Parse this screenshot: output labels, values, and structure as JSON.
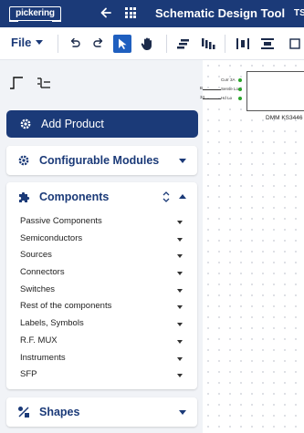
{
  "app": {
    "logo_text": "pickering",
    "title": "Schematic Design Tool",
    "title_extra": "TS"
  },
  "toolbar": {
    "file_label": "File",
    "tools": [
      "undo-icon",
      "redo-icon",
      "select-pointer-icon",
      "pan-hand-icon",
      "align-left-icon",
      "align-bottom-icon",
      "distribute-horizontal-icon",
      "distribute-vertical-icon"
    ],
    "active_tool": "select-pointer-icon"
  },
  "sidebar": {
    "add_product": {
      "label": "Add Product",
      "icon": "gear-icon"
    },
    "sections": {
      "configurable_modules": {
        "title": "Configurable Modules",
        "icon": "gear-icon",
        "expanded": false
      },
      "components": {
        "title": "Components",
        "icon": "puzzle-icon",
        "expanded": true,
        "items": [
          "Passive Components",
          "Semiconductors",
          "Sources",
          "Connectors",
          "Switches",
          "Rest of the components",
          "Labels, Symbols",
          "R.F. MUX",
          "Instruments",
          "SFP"
        ]
      },
      "shapes": {
        "title": "Shapes",
        "icon": "shapes-icon",
        "expanded": false
      }
    }
  },
  "canvas": {
    "device_label": "DMM KS3446",
    "ports": [
      "Curr 3A",
      "Sense Lo",
      "Hd Lo"
    ],
    "wire_labels": [
      "B",
      "34"
    ]
  },
  "colors": {
    "brand": "#1b3a78",
    "active_tool": "#1f5fbf",
    "port": "#2aa52a"
  }
}
